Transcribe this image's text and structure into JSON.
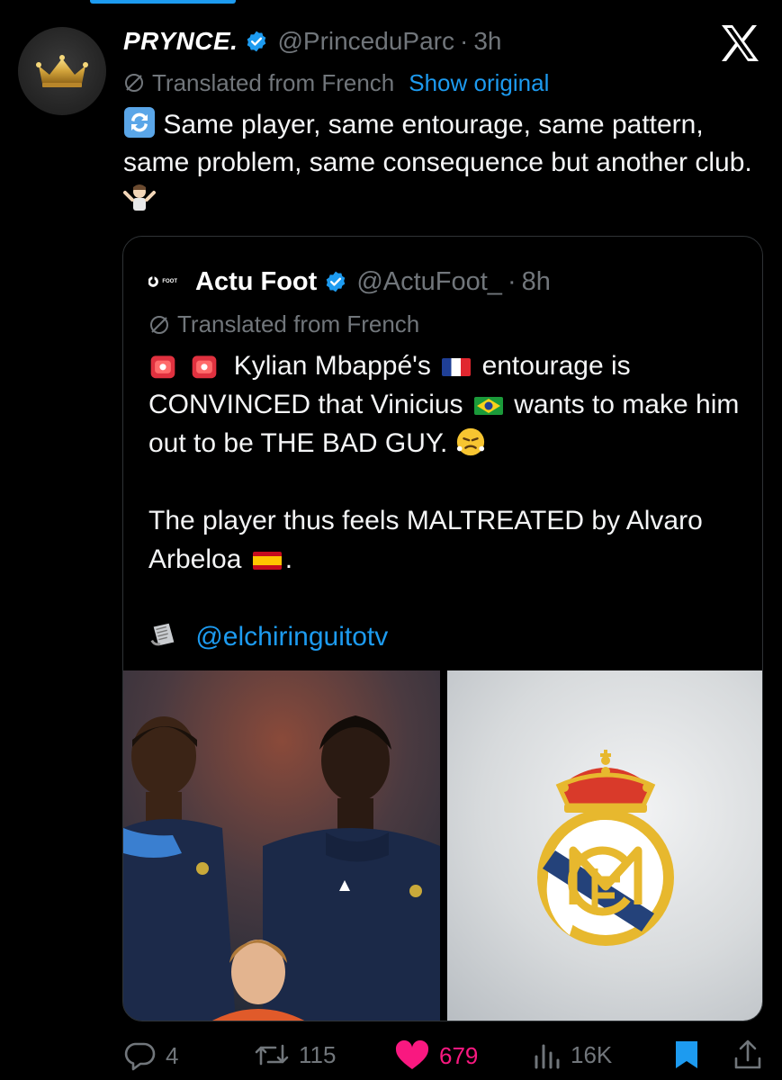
{
  "tweet": {
    "display_name": "PRYNCE.",
    "handle": "@PrinceduParc",
    "separator": "·",
    "time": "3h",
    "translated_label": "Translated from French",
    "show_original_label": "Show original",
    "text": "Same player, same entourage, same pattern, same problem, same consequence but another club."
  },
  "quoted": {
    "logo_text": "FOOT",
    "display_name": "Actu Foot",
    "handle": "@ActuFoot_",
    "separator": "·",
    "time": "8h",
    "translated_label": "Translated from French",
    "line1_a": "Kylian Mbappé's",
    "line1_b": "entourage is CONVINCED that Vinicius",
    "line1_c": "wants to make him out to be THE BAD GUY.",
    "line2_a": "The player thus feels MALTREATED by Alvaro Arbeloa",
    "line2_b": ".",
    "mention": "@elchiringuitotv"
  },
  "actions": {
    "replies": "4",
    "retweets": "115",
    "likes": "679",
    "views": "16K"
  },
  "colors": {
    "accent": "#1d9bf0",
    "like": "#f91880",
    "muted": "#71767b",
    "background": "#000000"
  },
  "icons": [
    "verified-badge-icon",
    "x-logo-icon",
    "translate-globe-icon",
    "reply-icon",
    "retweet-icon",
    "like-icon",
    "views-icon",
    "bookmark-icon",
    "share-icon"
  ]
}
